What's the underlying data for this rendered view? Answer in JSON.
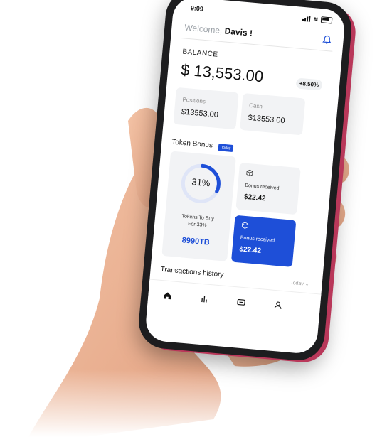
{
  "status": {
    "time": "9:09"
  },
  "header": {
    "greeting": "Welcome,",
    "user": "Davis !"
  },
  "balance": {
    "label": "BALANCE",
    "value": "$ 13,553.00",
    "change": "+8.50%"
  },
  "cards": {
    "positions": {
      "label": "Positions",
      "value": "$13553.00"
    },
    "cash": {
      "label": "Cash",
      "value": "$13553.00"
    }
  },
  "token_bonus": {
    "label": "Token Bonus",
    "badge": "Today",
    "percent": "31%",
    "percent_value": 31,
    "caption_line1": "Tokens To Buy",
    "caption_line2": "For 33%",
    "amount": "8990TB",
    "bonus_cards": [
      {
        "label": "Bonus received",
        "value": "$22.42"
      },
      {
        "label": "Bonus received",
        "value": "$22.42"
      }
    ]
  },
  "transactions": {
    "label": "Transactions history",
    "filter": "Today"
  },
  "nav": [
    "home-icon",
    "chart-icon",
    "wallet-icon",
    "profile-icon"
  ],
  "colors": {
    "accent": "#1e4fd8",
    "phone_edge": "#b9385a"
  }
}
